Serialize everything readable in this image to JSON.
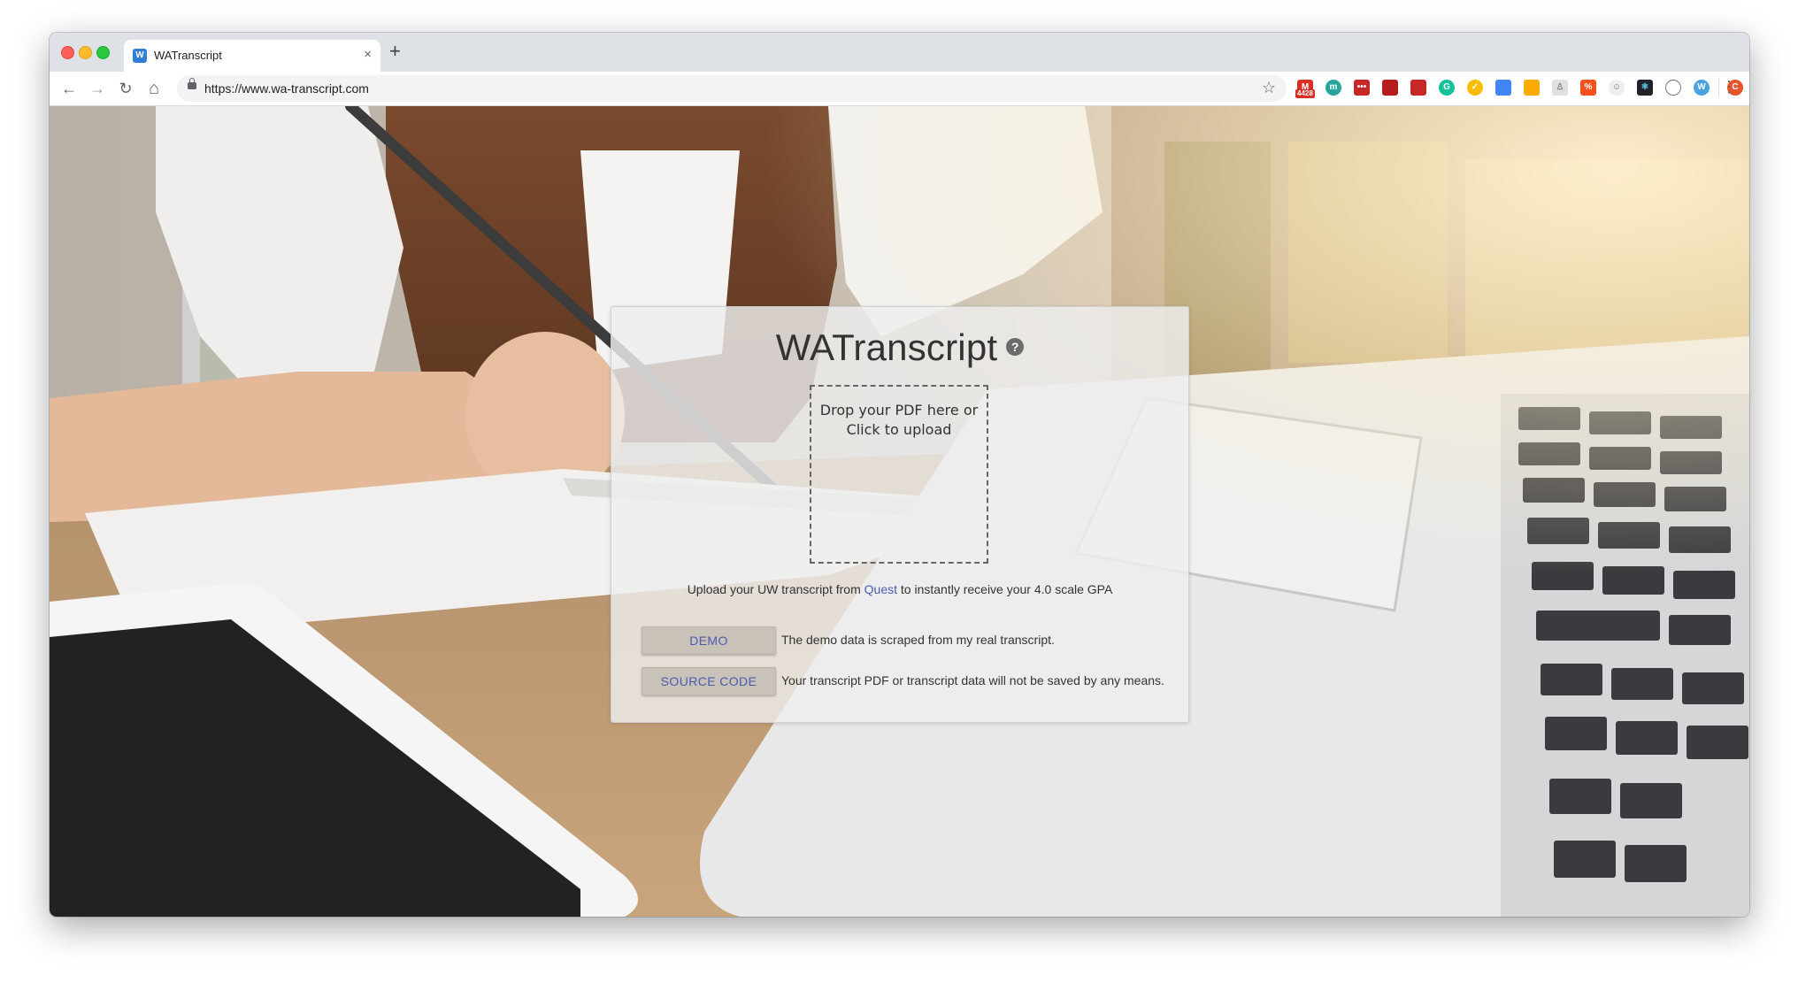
{
  "browser": {
    "tab": {
      "title": "WATranscript",
      "favicon_text": "W"
    },
    "new_tab_label": "+",
    "close_tab_label": "×",
    "nav": {
      "back": "←",
      "forward": "→",
      "reload": "↻",
      "home": "⌂"
    },
    "url": "https://www.wa-transcript.com",
    "bookmark_star": "☆",
    "menu": "⋮",
    "extensions": {
      "gmail_badge": "4428",
      "profile_letter": "C"
    }
  },
  "app": {
    "title": "WATranscript",
    "help_glyph": "?",
    "dropzone": {
      "line1": "Drop your PDF here or",
      "line2": "Click to upload"
    },
    "caption": {
      "before": "Upload your UW transcript from ",
      "link": "Quest",
      "after": " to instantly receive your 4.0 scale GPA"
    },
    "demo_button": "DEMO",
    "demo_note": "The demo data is scraped from my real transcript.",
    "source_button": "SOURCE CODE",
    "source_note": "Your transcript PDF or transcript data will not be saved by any means."
  },
  "colors": {
    "link": "#4a5bb0",
    "card_bg": "#eeeeee",
    "button_bg": "#c9c2b9"
  }
}
